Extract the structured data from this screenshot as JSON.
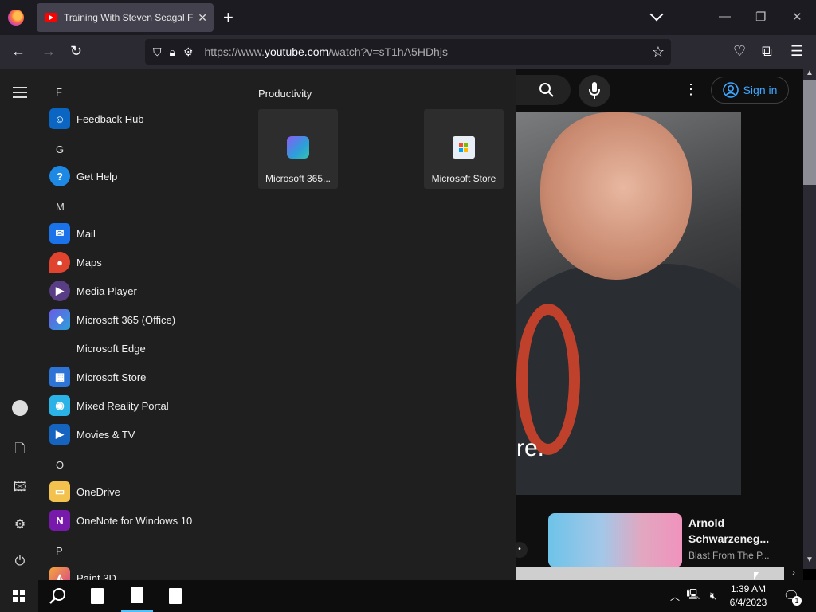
{
  "browser": {
    "tab_title": "Training With Steven Seagal For",
    "url_prefix": "https://www.",
    "url_domain": "youtube.com",
    "url_rest": "/watch?v=sT1hA5HDhjs"
  },
  "youtube": {
    "sign_in": "Sign in",
    "caption": "re.",
    "rec_title": "Arnold Schwarzeneg...",
    "rec_channel": "Blast From The P..."
  },
  "start_menu": {
    "letters": {
      "f": "F",
      "g": "G",
      "m": "M",
      "o": "O",
      "p": "P"
    },
    "apps": {
      "feedback": "Feedback Hub",
      "gethelp": "Get Help",
      "mail": "Mail",
      "maps": "Maps",
      "media": "Media Player",
      "m365": "Microsoft 365 (Office)",
      "edge": "Microsoft Edge",
      "store": "Microsoft Store",
      "mixed": "Mixed Reality Portal",
      "movies": "Movies & TV",
      "onedrive": "OneDrive",
      "onenote": "OneNote for Windows 10",
      "paint3d": "Paint 3D"
    },
    "group_title": "Productivity",
    "tiles": {
      "m365": "Microsoft 365...",
      "store": "Microsoft Store"
    }
  },
  "taskbar": {
    "time": "1:39 AM",
    "date": "6/4/2023",
    "notif_count": "1"
  },
  "colors": {
    "accent": "#3ea6ff",
    "start_bg": "#1f1f1f",
    "chrome_bg": "#2b2a33"
  }
}
